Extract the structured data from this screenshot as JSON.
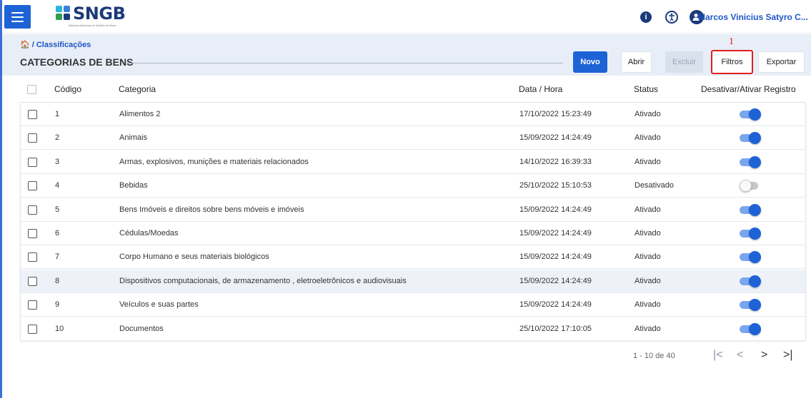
{
  "header": {
    "logo_text": "SNGB",
    "logo_subtitle": "Sistema Nacional de Gestão de Bens",
    "user_name": "Marcos Vinicius Satyro C...",
    "info_icon": "info-icon",
    "accessibility_icon": "accessibility-icon",
    "user_icon": "user-icon"
  },
  "subheader": {
    "breadcrumb": "🏠 / Classificações",
    "title": "CATEGORIAS DE BENS",
    "annotation": "1"
  },
  "toolbar": {
    "novo": "Novo",
    "abrir": "Abrir",
    "excluir": "Excluir",
    "filtros": "Filtros",
    "exportar": "Exportar"
  },
  "table": {
    "headers": {
      "codigo": "Código",
      "categoria": "Categoria",
      "data_hora": "Data / Hora",
      "status": "Status",
      "toggle": "Desativar/Ativar Registro"
    },
    "rows": [
      {
        "codigo": "1",
        "categoria": "Alimentos 2",
        "data_hora": "17/10/2022 15:23:49",
        "status": "Ativado",
        "active": true
      },
      {
        "codigo": "2",
        "categoria": "Animais",
        "data_hora": "15/09/2022 14:24:49",
        "status": "Ativado",
        "active": true
      },
      {
        "codigo": "3",
        "categoria": "Armas, explosivos, munições e materiais relacionados",
        "data_hora": "14/10/2022 16:39:33",
        "status": "Ativado",
        "active": true
      },
      {
        "codigo": "4",
        "categoria": "Bebidas",
        "data_hora": "25/10/2022 15:10:53",
        "status": "Desativado",
        "active": false
      },
      {
        "codigo": "5",
        "categoria": "Bens Imóveis e direitos sobre bens móveis e imóveis",
        "data_hora": "15/09/2022 14:24:49",
        "status": "Ativado",
        "active": true
      },
      {
        "codigo": "6",
        "categoria": "Cédulas/Moedas",
        "data_hora": "15/09/2022 14:24:49",
        "status": "Ativado",
        "active": true
      },
      {
        "codigo": "7",
        "categoria": "Corpo Humano e seus materiais biológicos",
        "data_hora": "15/09/2022 14:24:49",
        "status": "Ativado",
        "active": true
      },
      {
        "codigo": "8",
        "categoria": "Dispositivos computacionais, de armazenamento , eletroeletrônicos e audiovisuais",
        "data_hora": "15/09/2022 14:24:49",
        "status": "Ativado",
        "active": true
      },
      {
        "codigo": "9",
        "categoria": "Veículos e suas partes",
        "data_hora": "15/09/2022 14:24:49",
        "status": "Ativado",
        "active": true
      },
      {
        "codigo": "10",
        "categoria": "Documentos",
        "data_hora": "25/10/2022 17:10:05",
        "status": "Ativado",
        "active": true
      }
    ]
  },
  "pagination": {
    "range": "1 - 10 de 40",
    "first": "|<",
    "prev": "<",
    "next": ">",
    "last": ">|"
  }
}
